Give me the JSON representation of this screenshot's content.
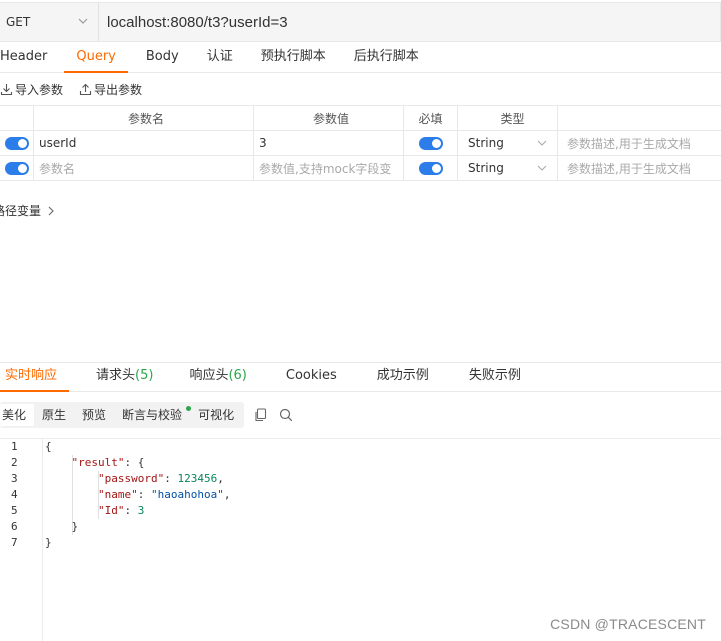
{
  "request": {
    "method": "GET",
    "url": "localhost:8080/t3?userId=3"
  },
  "req_tabs": [
    "Header",
    "Query",
    "Body",
    "认证",
    "预执行脚本",
    "后执行脚本"
  ],
  "active_req_tab": "Query",
  "import_label": "导入参数",
  "export_label": "导出参数",
  "params_table": {
    "headers": [
      "参数名",
      "参数值",
      "必填",
      "类型"
    ],
    "rows": [
      {
        "enabled": true,
        "name": "userId",
        "value": "3",
        "required": true,
        "type": "String",
        "desc_placeholder": "参数描述,用于生成文档"
      }
    ],
    "empty_row": {
      "name_placeholder": "参数名",
      "value_placeholder": "参数值,支持mock字段变",
      "type": "String",
      "desc_placeholder": "参数描述,用于生成文档"
    }
  },
  "path_vars_label": "路径变量",
  "resp_tabs": {
    "realtime": "实时响应",
    "req_headers": "请求头",
    "req_headers_count": "(5)",
    "resp_headers": "响应头",
    "resp_headers_count": "(6)",
    "cookies": "Cookies",
    "success_example": "成功示例",
    "fail_example": "失败示例"
  },
  "view_buttons": [
    "美化",
    "原生",
    "预览",
    "断言与校验",
    "可视化"
  ],
  "code": {
    "line_numbers": [
      "1",
      "2",
      "3",
      "4",
      "5",
      "6",
      "7"
    ],
    "open_brace": "{",
    "result_key": "\"result\"",
    "password_key": "\"password\"",
    "password_val": "123456",
    "name_key": "\"name\"",
    "name_val": "\"haoahohoa\"",
    "id_key": "\"Id\"",
    "id_val": "3",
    "inner_close": "}",
    "outer_close": "}"
  },
  "watermark": "CSDN @TRACESCENT",
  "colors": {
    "accent": "#ff6a00",
    "toggle": "#2b7de9",
    "count_green": "#2ba64a"
  }
}
